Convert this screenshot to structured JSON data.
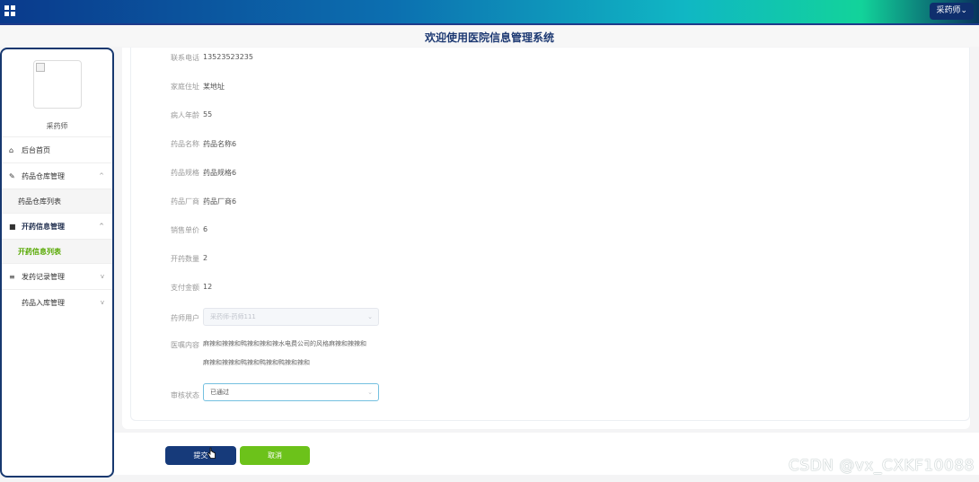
{
  "header": {
    "user_menu": "采药师⌄",
    "page_title": "欢迎使用医院信息管理系统"
  },
  "sidebar": {
    "username": "采药师",
    "items": [
      {
        "label": "后台首页"
      },
      {
        "label": "药品仓库管理"
      },
      {
        "label": "药品仓库列表"
      },
      {
        "label": "开药信息管理"
      },
      {
        "label": "开药信息列表"
      },
      {
        "label": "发药记录管理"
      },
      {
        "label": "药品入库管理"
      }
    ]
  },
  "form": {
    "fields": [
      {
        "label": "联系电话",
        "value": "13523523235"
      },
      {
        "label": "家庭住址",
        "value": "某地址"
      },
      {
        "label": "病人年龄",
        "value": "55"
      },
      {
        "label": "药品名称",
        "value": "药品名称6"
      },
      {
        "label": "药品规格",
        "value": "药品规格6"
      },
      {
        "label": "药品厂商",
        "value": "药品厂商6"
      },
      {
        "label": "销售单价",
        "value": "6"
      },
      {
        "label": "开药数量",
        "value": "2"
      },
      {
        "label": "支付金额",
        "value": "12"
      }
    ],
    "pharmacist_label": "药师用户",
    "pharmacist_value": "采药师-药师111",
    "remark_label": "医嘱内容",
    "remark_line1": "麻辣和辣辣和鸭辣和辣和辣水电费公司的风格麻辣和辣辣和",
    "remark_line2": "麻辣和辣辣和鸭辣和鸭辣和鸭辣和辣和",
    "status_label": "审核状态",
    "status_value": "已通过"
  },
  "actions": {
    "submit_label": "提交",
    "cancel_label": "取消"
  },
  "watermark": "CSDN @vx_CXKF10088",
  "colors": {
    "primary": "#163a7a",
    "success": "#6cc21a",
    "active_submenu": "#56a800"
  }
}
